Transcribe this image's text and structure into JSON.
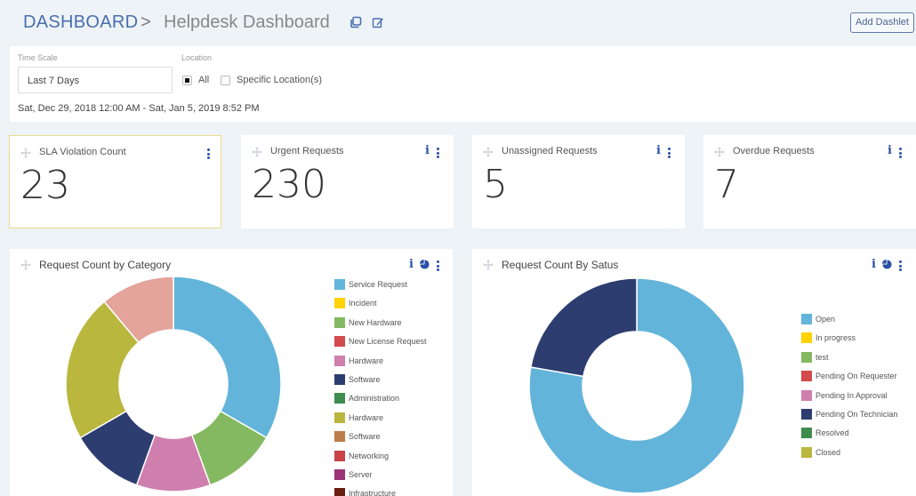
{
  "header": {
    "breadcrumb_root": "DASHBOARD",
    "breadcrumb_separator": ">",
    "title": "Helpdesk Dashboard",
    "icons": [
      "copy-icon",
      "edit-icon"
    ],
    "add_dashlet_label": "Add Dashlet"
  },
  "filters": {
    "time_scale_label": "Time Scale",
    "time_scale_value": "Last 7 Days",
    "location_label": "Location",
    "location_options": [
      {
        "label": "All",
        "checked": true
      },
      {
        "label": "Specific Location(s)",
        "checked": false
      }
    ],
    "date_range": "Sat, Dec 29, 2018 12:00 AM - Sat, Jan 5, 2019 8:52 PM"
  },
  "cards": [
    {
      "title": "SLA Violation Count",
      "value": "23",
      "has_info": false,
      "highlighted": true
    },
    {
      "title": "Urgent Requests",
      "value": "230",
      "has_info": true,
      "highlighted": false
    },
    {
      "title": "Unassigned Requests",
      "value": "5",
      "has_info": true,
      "highlighted": false
    },
    {
      "title": "Overdue Requests",
      "value": "7",
      "has_info": true,
      "highlighted": false
    }
  ],
  "colors": {
    "accent": "#2a4fa8",
    "breadcrumb": "#4a6fae",
    "highlight_border": "#e8dc8a",
    "background": "#eef3f7"
  },
  "chart_data": [
    {
      "type": "pie",
      "variant": "donut",
      "title": "Request Count by Category",
      "legend_position": "right",
      "legend": [
        {
          "label": "Service Request",
          "color": "#63b4da"
        },
        {
          "label": "Incident",
          "color": "#ffd200"
        },
        {
          "label": "New Hardware",
          "color": "#84b961"
        },
        {
          "label": "New License Request",
          "color": "#d34a4f"
        },
        {
          "label": "Hardware",
          "color": "#cf7fae"
        },
        {
          "label": "Software",
          "color": "#2d3d70"
        },
        {
          "label": "Administration",
          "color": "#3f8c4f"
        },
        {
          "label": "Hardware",
          "color": "#bab73e"
        },
        {
          "label": "Software",
          "color": "#bd7c49"
        },
        {
          "label": "Networking",
          "color": "#c94248"
        },
        {
          "label": "Server",
          "color": "#9a3476"
        },
        {
          "label": "Infrastructure",
          "color": "#6a1f12"
        }
      ],
      "slices": [
        {
          "label": "Service Request",
          "value": 3,
          "color": "#63b4da"
        },
        {
          "label": "New Hardware",
          "value": 1,
          "color": "#84b961"
        },
        {
          "label": "Hardware",
          "value": 1,
          "color": "#cf7fae"
        },
        {
          "label": "Software",
          "value": 1,
          "color": "#2d3d70"
        },
        {
          "label": "Hardware",
          "value": 2,
          "color": "#bab73e"
        },
        {
          "label": "",
          "value": 1,
          "color": "#e4a39b"
        }
      ]
    },
    {
      "type": "pie",
      "variant": "donut",
      "title": "Request Count By Satus",
      "legend_position": "right",
      "legend": [
        {
          "label": "Open",
          "color": "#63b4da"
        },
        {
          "label": "In progress",
          "color": "#ffd200"
        },
        {
          "label": "test",
          "color": "#84b961"
        },
        {
          "label": "Pending On Requester",
          "color": "#d34a4f"
        },
        {
          "label": "Pending In Approval",
          "color": "#cf7fae"
        },
        {
          "label": "Pending On Technician",
          "color": "#2d3d70"
        },
        {
          "label": "Resolved",
          "color": "#3f8c4f"
        },
        {
          "label": "Closed",
          "color": "#bab73e"
        }
      ],
      "slices": [
        {
          "label": "Open",
          "value": 7,
          "color": "#63b4da"
        },
        {
          "label": "Pending On Technician",
          "value": 2,
          "color": "#2d3d70"
        }
      ]
    }
  ]
}
